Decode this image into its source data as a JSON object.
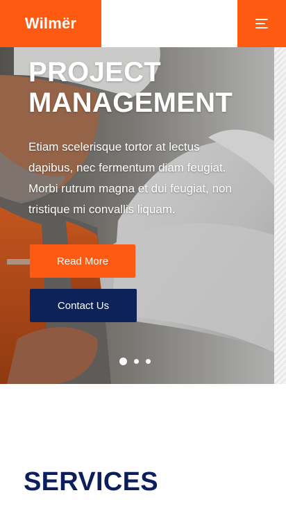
{
  "header": {
    "logo": "Wilmër",
    "menu_icon": "hamburger-menu-icon",
    "accent_color": "#ff5a12"
  },
  "hero": {
    "title_line1": "PROJECT",
    "title_line2": "MANAGEMENT",
    "description": "Etiam scelerisque tortor at lectus dapibus, nec fermentum diam feugiat. Morbi rutrum magna et dui feugiat, non tristique mi convallis liquam.",
    "read_more_label": "Read More",
    "contact_label": "Contact Us",
    "slides_count": 3,
    "active_slide": 1,
    "image": "construction-worker-hardhat-blueprints"
  },
  "services": {
    "title": "SERVICES",
    "title_color": "#0c1f5c"
  },
  "colors": {
    "primary": "#ff5a12",
    "secondary": "#0c2258",
    "background": "#ffffff"
  }
}
